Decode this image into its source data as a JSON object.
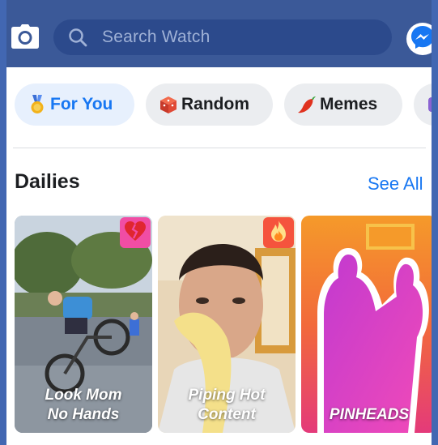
{
  "colors": {
    "brand": "#3b5998",
    "search_bg": "#2c4a8c",
    "accent": "#1877f2",
    "chip_bg": "#ebedf0",
    "chip_active_bg": "#e7f0fd"
  },
  "header": {
    "camera_icon": "camera-icon",
    "search": {
      "placeholder": "Search Watch",
      "icon": "search-icon"
    },
    "messenger_icon": "messenger-icon"
  },
  "chips": [
    {
      "label": "For You",
      "icon": "medal-icon",
      "active": true
    },
    {
      "label": "Random",
      "icon": "cube-icon",
      "active": false
    },
    {
      "label": "Memes",
      "icon": "chili-pepper-icon",
      "active": false
    }
  ],
  "dailies": {
    "title": "Dailies",
    "see_all": "See All",
    "cards": [
      {
        "title_line1": "Look Mom",
        "title_line2": "No Hands",
        "badge_icon": "broken-heart-icon"
      },
      {
        "title_line1": "Piping Hot",
        "title_line2": "Content",
        "badge_icon": "fire-icon"
      },
      {
        "title_line1": "PINHEADS",
        "title_line2": ""
      }
    ]
  }
}
